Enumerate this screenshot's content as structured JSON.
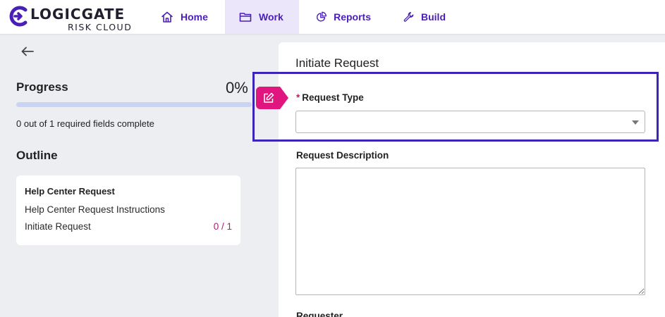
{
  "brand": {
    "name": "LOGICGATE",
    "subtitle": "RISK CLOUD",
    "accent_color": "#4a1fb8",
    "tag_color": "#e0167e"
  },
  "nav": {
    "items": [
      {
        "label": "Home",
        "icon": "home-icon",
        "active": false
      },
      {
        "label": "Work",
        "icon": "folder-icon",
        "active": true
      },
      {
        "label": "Reports",
        "icon": "pie-chart-icon",
        "active": false
      },
      {
        "label": "Build",
        "icon": "wrench-icon",
        "active": false
      }
    ]
  },
  "sidebar": {
    "back_icon": "arrow-left-icon",
    "progress": {
      "title": "Progress",
      "percent_text": "0%",
      "value": 0,
      "status": "0 out of 1 required fields complete"
    },
    "outline": {
      "title": "Outline",
      "card": {
        "heading": "Help Center Request",
        "items": [
          {
            "label": "Help Center Request Instructions",
            "count": ""
          },
          {
            "label": "Initiate Request",
            "count": "0 / 1"
          }
        ]
      }
    }
  },
  "form": {
    "title": "Initiate Request",
    "tag_icon": "edit-icon",
    "fields": {
      "request_type": {
        "required_mark": "*",
        "label": "Request Type",
        "value": ""
      },
      "request_description": {
        "label": "Request Description",
        "value": ""
      },
      "requester": {
        "label": "Requester"
      }
    }
  }
}
